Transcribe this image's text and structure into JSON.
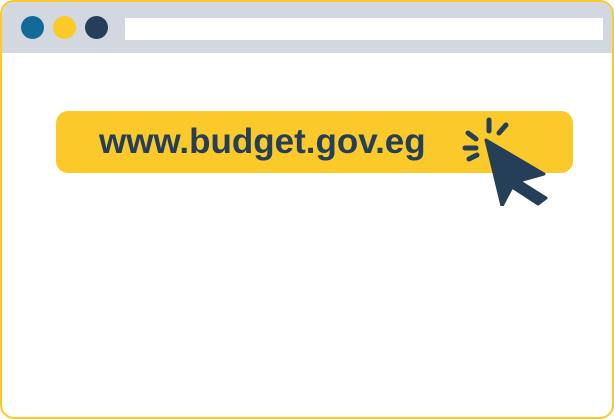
{
  "window": {
    "accent_color": "#fcc92a",
    "titlebar_color": "#d3d7df",
    "dot_colors": [
      "#126a99",
      "#fcc92a",
      "#253f59"
    ],
    "address_bar_value": ""
  },
  "link": {
    "url": "www.budget.gov.eg",
    "text_color": "#253f59",
    "pill_color": "#fcc92a",
    "icon": "cursor-click-icon"
  }
}
